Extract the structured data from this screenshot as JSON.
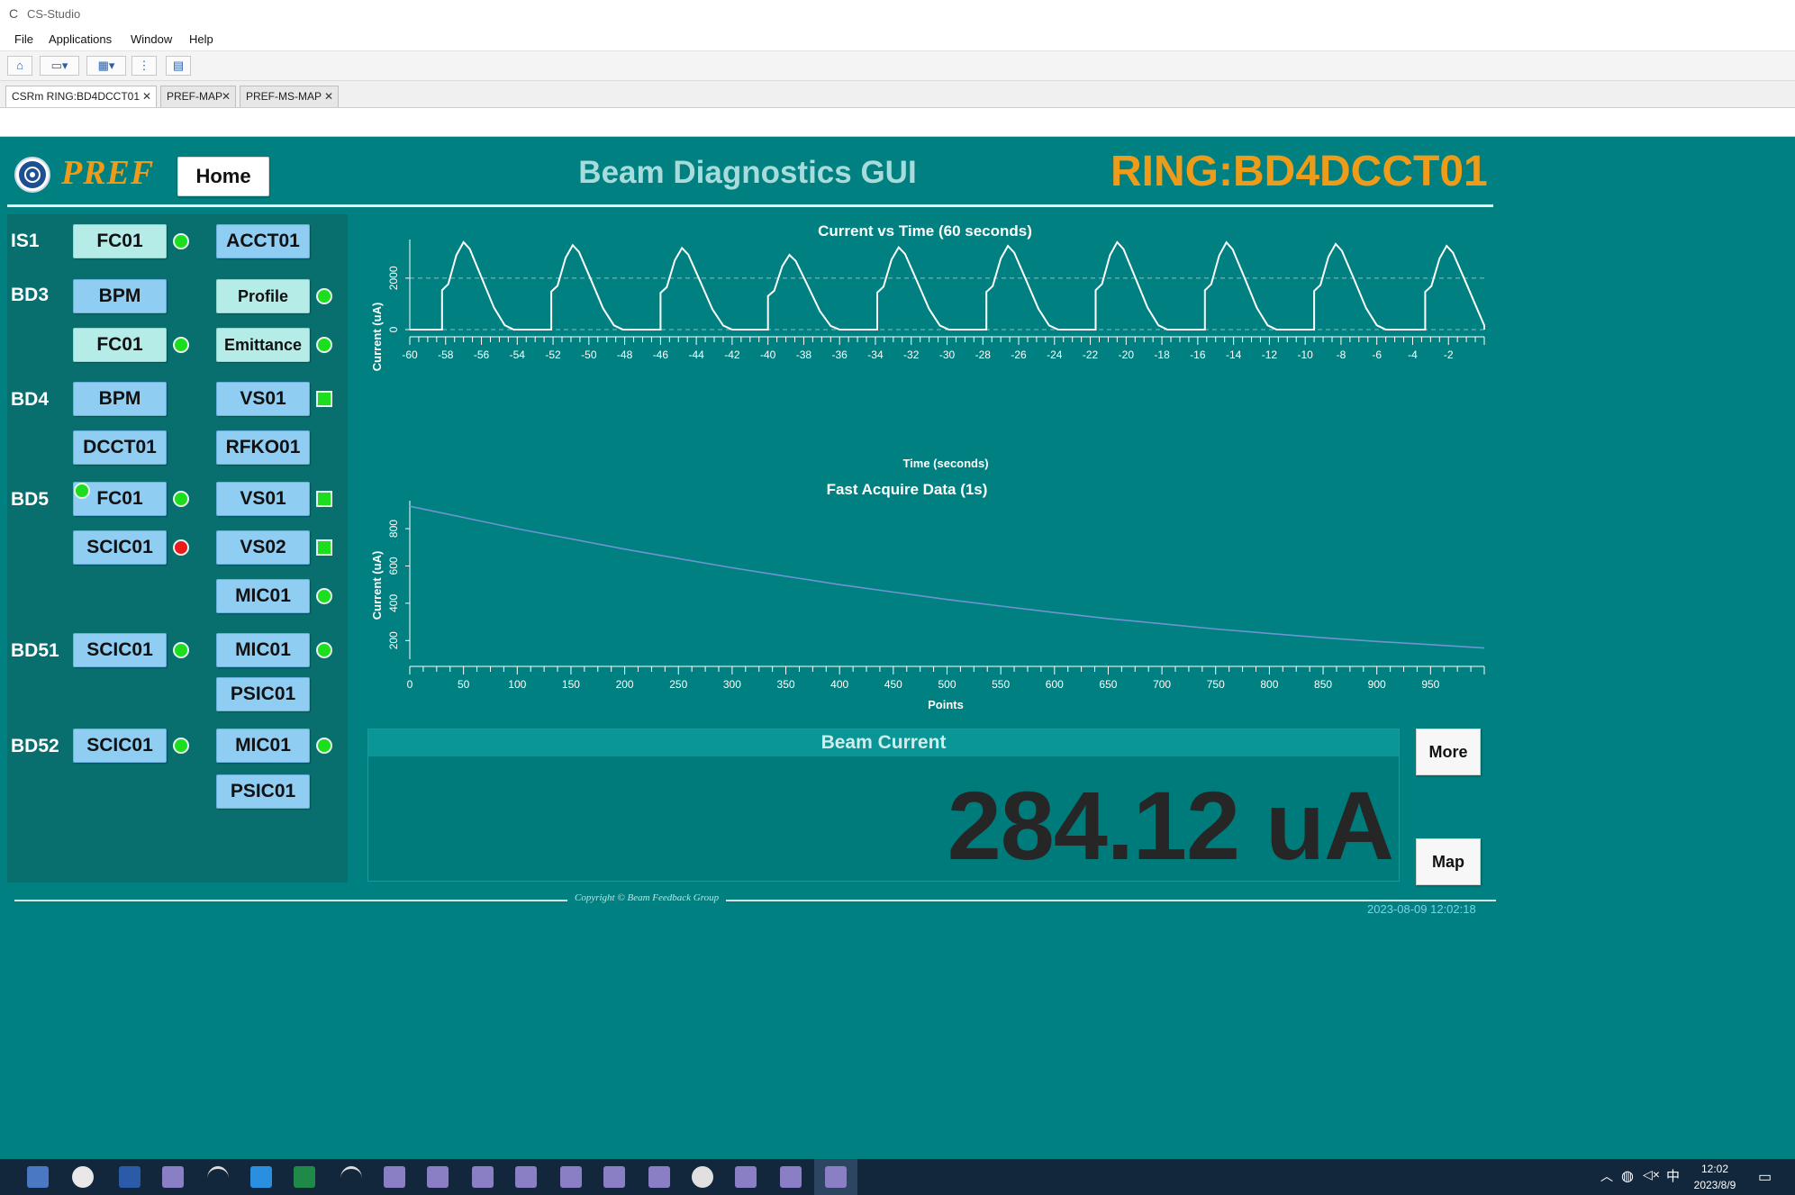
{
  "window": {
    "title": "CS-Studio"
  },
  "menu": [
    "File",
    "Applications",
    "Window",
    "Help"
  ],
  "tabs": [
    {
      "label": "CSRm  RING:BD4DCCT01"
    },
    {
      "label": "PREF-MAP"
    },
    {
      "label": "PREF-MS-MAP"
    }
  ],
  "header": {
    "brand": "PREF",
    "home_label": "Home",
    "title": "Beam Diagnostics GUI",
    "device": "RING:BD4DCCT01"
  },
  "nav": {
    "sections": {
      "is1": "IS1",
      "bd3": "BD3",
      "bd4": "BD4",
      "bd5": "BD5",
      "bd51": "BD51",
      "bd52": "BD52"
    },
    "buttons": {
      "is1_fc01": "FC01",
      "is1_acct01": "ACCT01",
      "bd3_bpm": "BPM",
      "bd3_profile": "Profile",
      "bd3_fc01": "FC01",
      "bd3_emittance": "Emittance",
      "bd4_bpm": "BPM",
      "bd4_vs01": "VS01",
      "bd4_dcct01": "DCCT01",
      "bd4_rfko01": "RFKO01",
      "bd5_fc01": "FC01",
      "bd5_vs01": "VS01",
      "bd5_scic01": "SCIC01",
      "bd5_vs02": "VS02",
      "bd5_mic01": "MIC01",
      "bd51_scic01": "SCIC01",
      "bd51_mic01": "MIC01",
      "bd51_psic01": "PSIC01",
      "bd52_scic01": "SCIC01",
      "bd52_mic01": "MIC01",
      "bd52_psic01": "PSIC01"
    },
    "status_colors": {
      "ok": "#1dde1d",
      "fault": "#ec1a1a"
    }
  },
  "beam": {
    "label": "Beam Current",
    "value": "284.12 uA",
    "more_label": "More",
    "map_label": "Map"
  },
  "footer": {
    "copyright": "Copyright © Beam Feedback Group",
    "timestamp": "2023-08-09 12:02:18"
  },
  "taskbar": {
    "time": "12:02",
    "date": "2023/8/9",
    "ime": "中"
  },
  "chart_data": [
    {
      "type": "line",
      "title": "Current vs Time (60 seconds)",
      "xlabel": "Time (seconds)",
      "ylabel": "Current (uA)",
      "xlim": [
        -60,
        0
      ],
      "ylim": [
        0,
        3500
      ],
      "x_ticks": [
        -60,
        -58,
        -56,
        -54,
        -52,
        -50,
        -48,
        -46,
        -44,
        -42,
        -40,
        -38,
        -36,
        -34,
        -32,
        -30,
        -28,
        -26,
        -24,
        -22,
        -20,
        -18,
        -16,
        -14,
        -12,
        -10,
        -8,
        -6,
        -4,
        -2
      ],
      "y_ticks": [
        0,
        2000
      ],
      "grid": "dashed horizontal",
      "series": [
        {
          "color": "#ffffff",
          "cycle_period_s": 6.1,
          "pulse_onsets_s": [
            -58.2,
            -52.1,
            -46.0,
            -40.0,
            -33.9,
            -27.8,
            -21.7,
            -15.6,
            -9.5,
            -3.3
          ],
          "pulse_peaks_uA": [
            3400,
            3280,
            3170,
            2900,
            3200,
            3250,
            3400,
            3390,
            3330,
            3250
          ],
          "baseline_uA": 0
        }
      ]
    },
    {
      "type": "line",
      "title": "Fast Acquire Data (1s)",
      "xlabel": "Points",
      "ylabel": "Current (uA)",
      "xlim": [
        0,
        1000
      ],
      "ylim": [
        100,
        950
      ],
      "x_ticks": [
        0,
        50,
        100,
        150,
        200,
        250,
        300,
        350,
        400,
        450,
        500,
        550,
        600,
        650,
        700,
        750,
        800,
        850,
        900,
        950
      ],
      "y_ticks": [
        200,
        400,
        600,
        800
      ],
      "series": [
        {
          "color": "#6c95d2",
          "x": [
            0,
            50,
            100,
            150,
            200,
            250,
            300,
            350,
            400,
            450,
            500,
            550,
            600,
            650,
            700,
            750,
            800,
            850,
            900,
            950,
            1000
          ],
          "y": [
            920,
            860,
            800,
            745,
            690,
            640,
            590,
            545,
            500,
            460,
            420,
            385,
            350,
            318,
            290,
            262,
            238,
            215,
            195,
            178,
            160
          ]
        }
      ]
    }
  ]
}
